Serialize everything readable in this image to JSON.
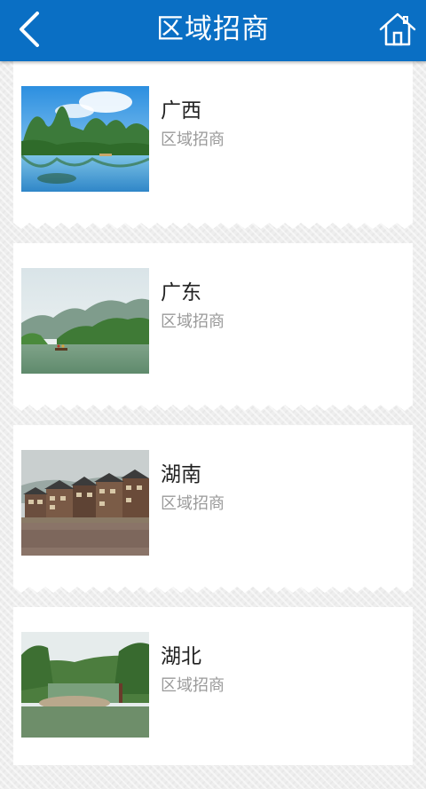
{
  "header": {
    "title": "区域招商",
    "back_icon": "chevron-left-icon",
    "home_icon": "home-icon",
    "color": "#0a6fc4"
  },
  "regions": [
    {
      "name": "广西",
      "subtitle": "区域招商",
      "image": "karst-river-landscape"
    },
    {
      "name": "广东",
      "subtitle": "区域招商",
      "image": "river-boat-mountains"
    },
    {
      "name": "湖南",
      "subtitle": "区域招商",
      "image": "riverside-stilt-houses"
    },
    {
      "name": "湖北",
      "subtitle": "区域招商",
      "image": "forest-stream-valley"
    }
  ]
}
